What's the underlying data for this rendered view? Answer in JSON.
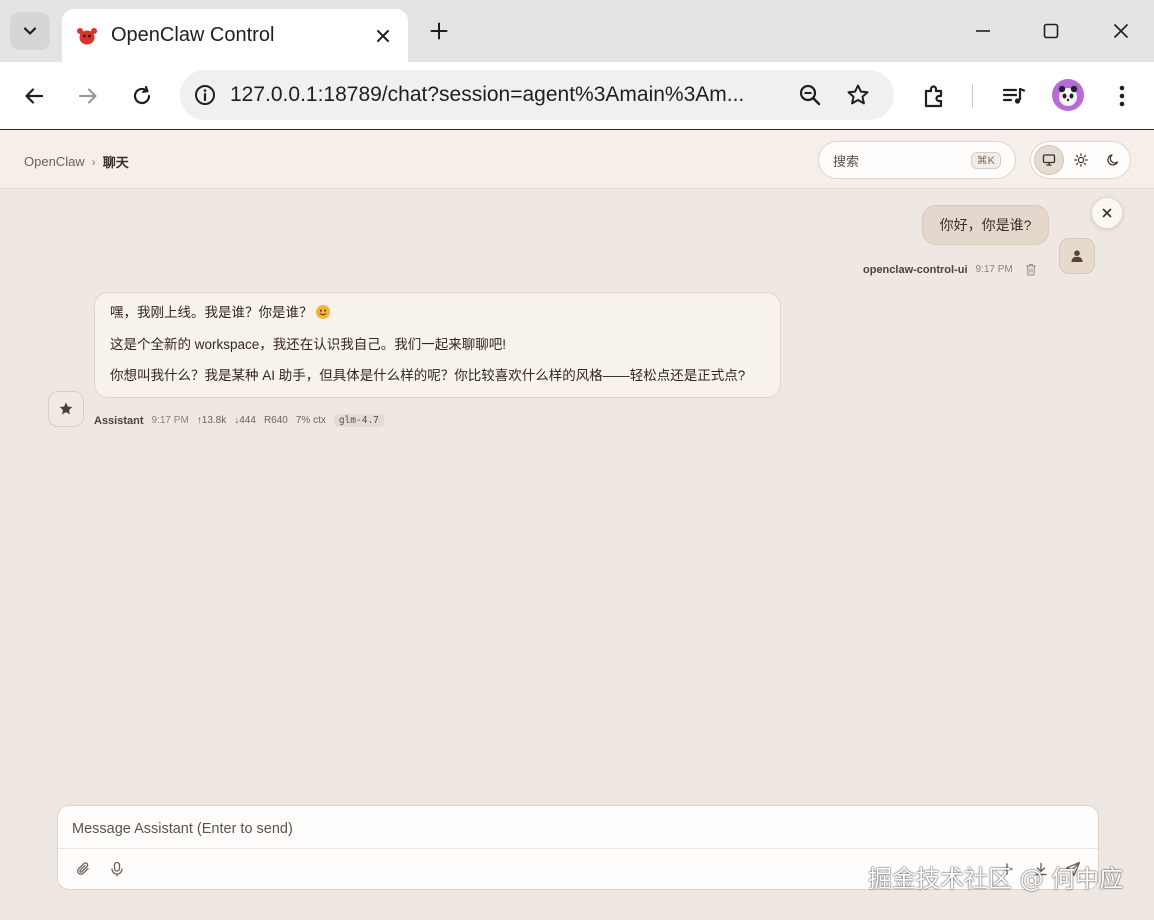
{
  "browser": {
    "tab": {
      "title": "OpenClaw Control",
      "favicon": "openclaw-lobster-icon"
    },
    "address_bar": {
      "url": "127.0.0.1:18789/chat?session=agent%3Amain%3Am..."
    },
    "colors": {
      "profile_avatar": "#b56cd9",
      "favicon": "#d9342b"
    }
  },
  "app": {
    "breadcrumb": {
      "root": "OpenClaw",
      "separator": "›",
      "current": "聊天"
    },
    "search": {
      "placeholder": "搜索",
      "shortcut": "⌘K"
    },
    "theme": {
      "options": [
        "system-display-icon",
        "light-sun-icon",
        "dark-moon-icon"
      ],
      "active": "system-display-icon"
    },
    "colors": {
      "background": "#efe7e1",
      "user_bubble": "#e4d8cd",
      "assistant_bubble": "#f8f2ec",
      "accent_text": "#3a2f27"
    }
  },
  "chat": {
    "messages": [
      {
        "role": "user",
        "text": "你好，你是谁?",
        "sender": "openclaw-control-ui",
        "time": "9:17 PM"
      },
      {
        "role": "assistant",
        "paragraphs": [
          "嘿，我刚上线。我是谁？你是谁？",
          "这是个全新的 workspace，我还在认识我自己。我们一起来聊聊吧!",
          "你想叫我什么？我是某种 AI 助手，但具体是什么样的呢？你比较喜欢什么样的风格——轻松点还是正式点?"
        ],
        "emoji": "smiling-face-emoji",
        "sender": "Assistant",
        "time": "9:17 PM",
        "stats": {
          "tokens_in": "↑13.8k",
          "tokens_out": "↓444",
          "reasoning": "R640",
          "context": "7% ctx"
        },
        "model": "glm-4.7"
      }
    ]
  },
  "composer": {
    "placeholder": "Message Assistant (Enter to send)"
  },
  "watermark": "掘金技术社区 @ 何中应"
}
